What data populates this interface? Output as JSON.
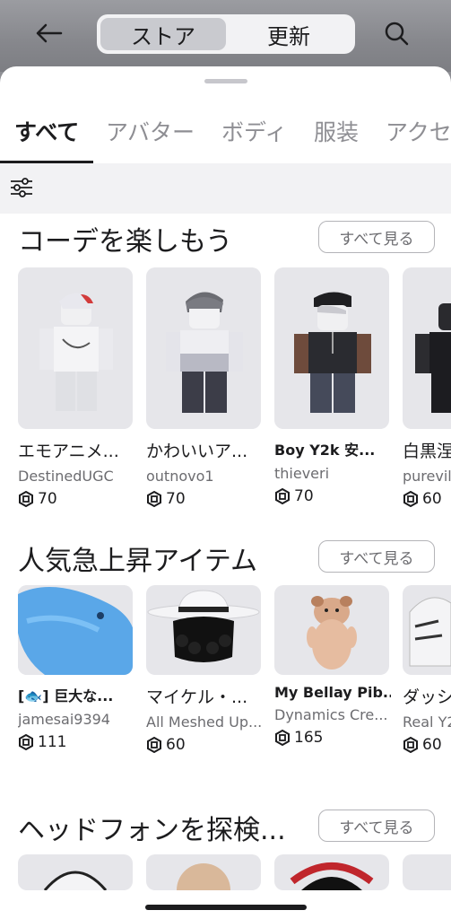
{
  "header": {
    "segments": [
      {
        "label": "ストア",
        "active": true
      },
      {
        "label": "更新",
        "active": false
      }
    ]
  },
  "category_tabs": [
    {
      "label": "すべて",
      "active": true
    },
    {
      "label": "アバター",
      "active": false
    },
    {
      "label": "ボディ",
      "active": false
    },
    {
      "label": "服装",
      "active": false
    },
    {
      "label": "アクセ",
      "active": false
    }
  ],
  "sections": [
    {
      "title": "コーデを楽しもう",
      "see_all_label": "すべて見る",
      "items": [
        {
          "name": "エモアニメ...",
          "creator": "DestinedUGC",
          "price": "70"
        },
        {
          "name": "かわいいア...",
          "creator": "outnovo1",
          "price": "70"
        },
        {
          "name": "Boy Y2k 安...",
          "creator": "thieveri",
          "price": "70"
        },
        {
          "name": "白黒涅",
          "creator": "purevil",
          "price": "60"
        }
      ]
    },
    {
      "title": "人気急上昇アイテム",
      "see_all_label": "すべて見る",
      "items": [
        {
          "name": "[🐟] 巨大な...",
          "creator": "jamesai9394",
          "price": "111"
        },
        {
          "name": "マイケル・...",
          "creator": "All Meshed Up...",
          "price": "60"
        },
        {
          "name": "My Bellay Pib...",
          "creator": "Dynamics Cre...",
          "price": "165"
        },
        {
          "name": "ダッシ",
          "creator": "Real Y2",
          "price": "60"
        }
      ]
    },
    {
      "title": "ヘッドフォンを探検...",
      "see_all_label": "すべて見る",
      "items": []
    }
  ],
  "icons": {
    "back": "arrow-left-icon",
    "search": "search-icon",
    "filter": "sliders-icon",
    "currency": "robux-icon"
  },
  "colors": {
    "accent_text": "#1c1c1e",
    "secondary_text": "#6c6c70",
    "tab_inactive": "#8e8e93",
    "filter_bar_bg": "#f2f2f4"
  }
}
